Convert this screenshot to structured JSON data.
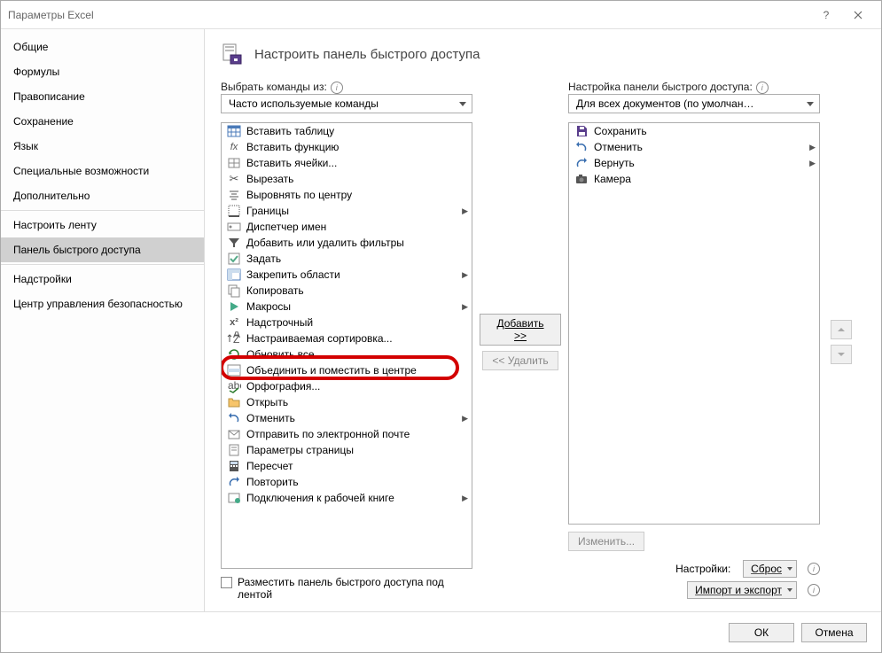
{
  "window": {
    "title": "Параметры Excel"
  },
  "sidebar": {
    "groups": [
      [
        "Общие",
        "Формулы",
        "Правописание",
        "Сохранение",
        "Язык",
        "Специальные возможности",
        "Дополнительно"
      ],
      [
        "Настроить ленту",
        "Панель быстрого доступа"
      ],
      [
        "Надстройки",
        "Центр управления безопасностью"
      ]
    ],
    "selected": "Панель быстрого доступа"
  },
  "main": {
    "title": "Настроить панель быстрого доступа",
    "left_label": "Выбрать команды из:",
    "left_select": "Часто используемые команды",
    "right_label": "Настройка панели быстрого доступа:",
    "right_select": "Для всех документов (по умолчан…",
    "add_btn": "Добавить >>",
    "remove_btn": "<< Удалить",
    "modify_btn": "Изменить...",
    "checkbox_label": "Разместить панель быстрого доступа под лентой",
    "settings_label": "Настройки:",
    "reset_btn": "Сброс",
    "import_btn": "Импорт и экспорт"
  },
  "left_list": [
    {
      "icon": "table",
      "label": "Вставить таблицу"
    },
    {
      "icon": "fx",
      "label": "Вставить функцию"
    },
    {
      "icon": "cells",
      "label": "Вставить ячейки..."
    },
    {
      "icon": "cut",
      "label": "Вырезать"
    },
    {
      "icon": "center",
      "label": "Выровнять по центру"
    },
    {
      "icon": "border",
      "label": "Границы",
      "submenu": true
    },
    {
      "icon": "names",
      "label": "Диспетчер имен"
    },
    {
      "icon": "filter",
      "label": "Добавить или удалить фильтры"
    },
    {
      "icon": "task",
      "label": "Задать"
    },
    {
      "icon": "freeze",
      "label": "Закрепить области",
      "submenu": true
    },
    {
      "icon": "copy",
      "label": "Копировать"
    },
    {
      "icon": "macro",
      "label": "Макросы",
      "submenu": true
    },
    {
      "icon": "super",
      "label": "Надстрочный"
    },
    {
      "icon": "sort",
      "label": "Настраиваемая сортировка..."
    },
    {
      "icon": "refresh",
      "label": "Обновить все"
    },
    {
      "icon": "merge",
      "label": "Объединить и поместить в центре",
      "highlighted": true
    },
    {
      "icon": "spell",
      "label": "Орфография..."
    },
    {
      "icon": "open",
      "label": "Открыть"
    },
    {
      "icon": "undo",
      "label": "Отменить",
      "submenu": true
    },
    {
      "icon": "mail",
      "label": "Отправить по электронной почте"
    },
    {
      "icon": "page",
      "label": "Параметры страницы"
    },
    {
      "icon": "recalc",
      "label": "Пересчет"
    },
    {
      "icon": "redo",
      "label": "Повторить"
    },
    {
      "icon": "conn",
      "label": "Подключения к рабочей книге",
      "submenu": true
    }
  ],
  "right_list": [
    {
      "icon": "save",
      "label": "Сохранить"
    },
    {
      "icon": "undo",
      "label": "Отменить",
      "submenu": true
    },
    {
      "icon": "redo",
      "label": "Вернуть",
      "submenu": true
    },
    {
      "icon": "camera",
      "label": "Камера"
    }
  ],
  "footer": {
    "ok": "ОК",
    "cancel": "Отмена"
  }
}
